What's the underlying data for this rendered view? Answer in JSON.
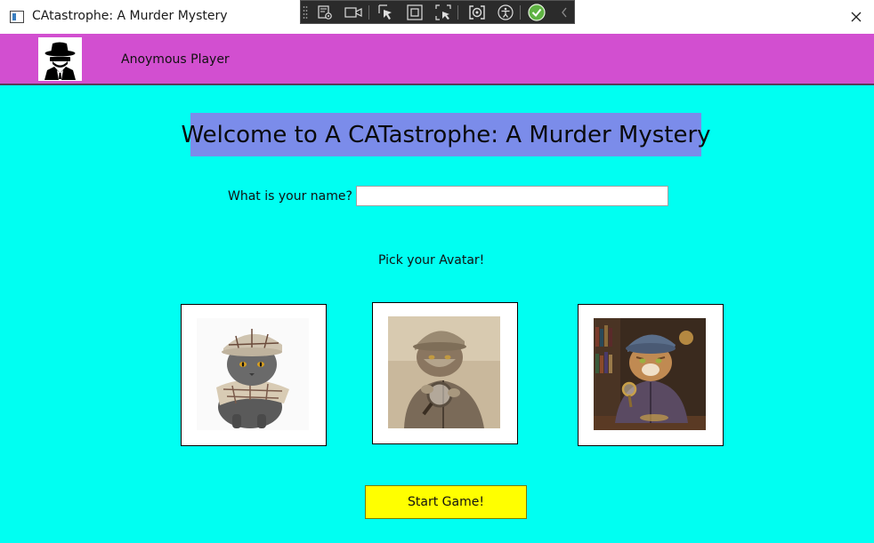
{
  "window": {
    "title": "CAtastrophe: A Murder Mystery",
    "background": "#00fff2"
  },
  "debug_toolbar": {
    "icons": [
      "drag-handle-icon",
      "live-visual-tree-icon",
      "record-icon",
      "select-element-icon",
      "display-layout-adorners-icon",
      "track-focus-icon",
      "binding-failures-icon",
      "accessibility-icon",
      "checkmark-icon",
      "collapse-chevron-icon"
    ]
  },
  "header": {
    "player_name": "Anoymous Player",
    "background": "#d24fd0",
    "avatar_icon": "spy-detective-icon"
  },
  "main": {
    "welcome": "Welcome to A CATastrophe: A Murder Mystery",
    "welcome_background": "#7b8cea",
    "name_label": "What is your name?",
    "name_value": "",
    "pick_label": "Pick your Avatar!",
    "avatars": [
      {
        "icon": "cat-plaid-deerstalker-avatar"
      },
      {
        "icon": "cat-magnifying-glass-avatar"
      },
      {
        "icon": "cat-detective-library-avatar"
      }
    ],
    "start_label": "Start Game!",
    "start_color": "#ffff00"
  }
}
